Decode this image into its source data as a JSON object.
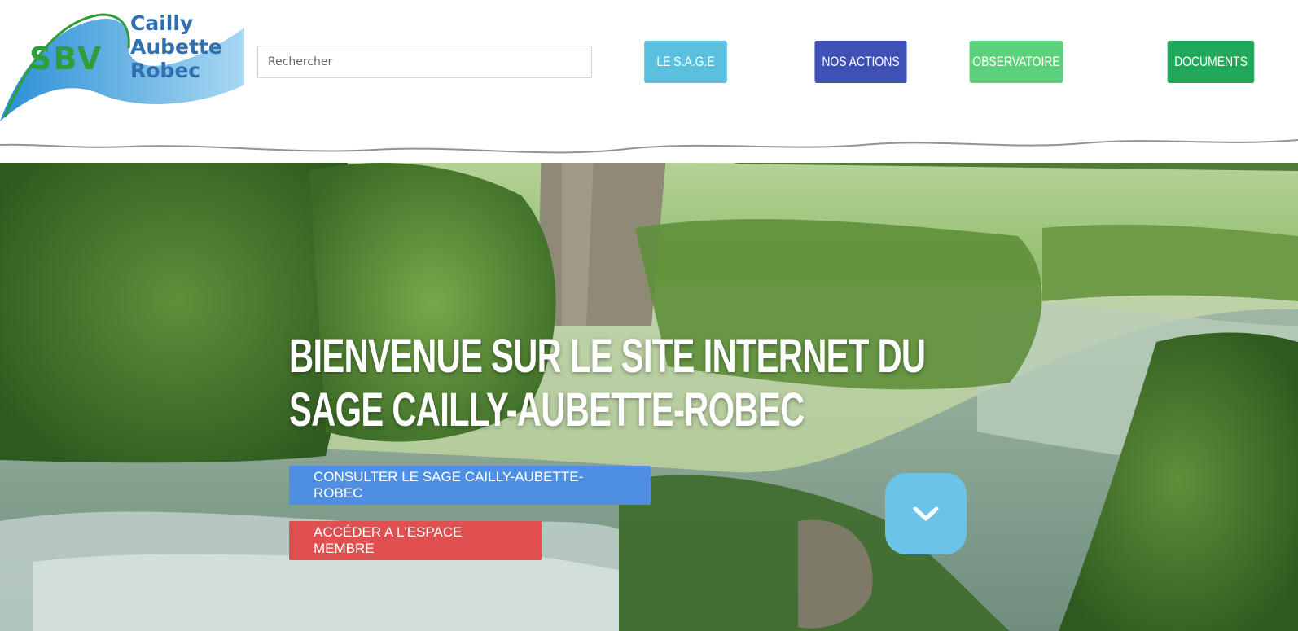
{
  "logo": {
    "initials": "SBV",
    "line1": "Cailly",
    "line2": "Aubette",
    "line3": "Robec"
  },
  "search": {
    "placeholder": "Rechercher"
  },
  "nav": {
    "items": [
      {
        "label": "LE S.A.G.E",
        "color": "#5bc0de"
      },
      {
        "label": "NOS ACTIONS",
        "color": "#3f51b5"
      },
      {
        "label": "OBSERVATOIRE",
        "color": "#5cd07a"
      },
      {
        "label": "DOCUMENTS",
        "color": "#22a85a"
      }
    ]
  },
  "hero": {
    "title_line1": "BIENVENUE SUR LE SITE INTERNET DU",
    "title_line2": "SAGE CAILLY-AUBETTE-ROBEC",
    "cta_primary": "CONSULTER LE SAGE CAILLY-AUBETTE-ROBEC",
    "cta_secondary": "ACCÉDER A L'ESPACE MEMBRE",
    "scroll_icon": "chevron-down-icon"
  },
  "colors": {
    "cta_primary": "#4f8fe3",
    "cta_secondary": "#e05050",
    "scroll_button": "#6cc3e8",
    "logo_blue": "#2f6fb0",
    "logo_green": "#2f9e3a"
  }
}
